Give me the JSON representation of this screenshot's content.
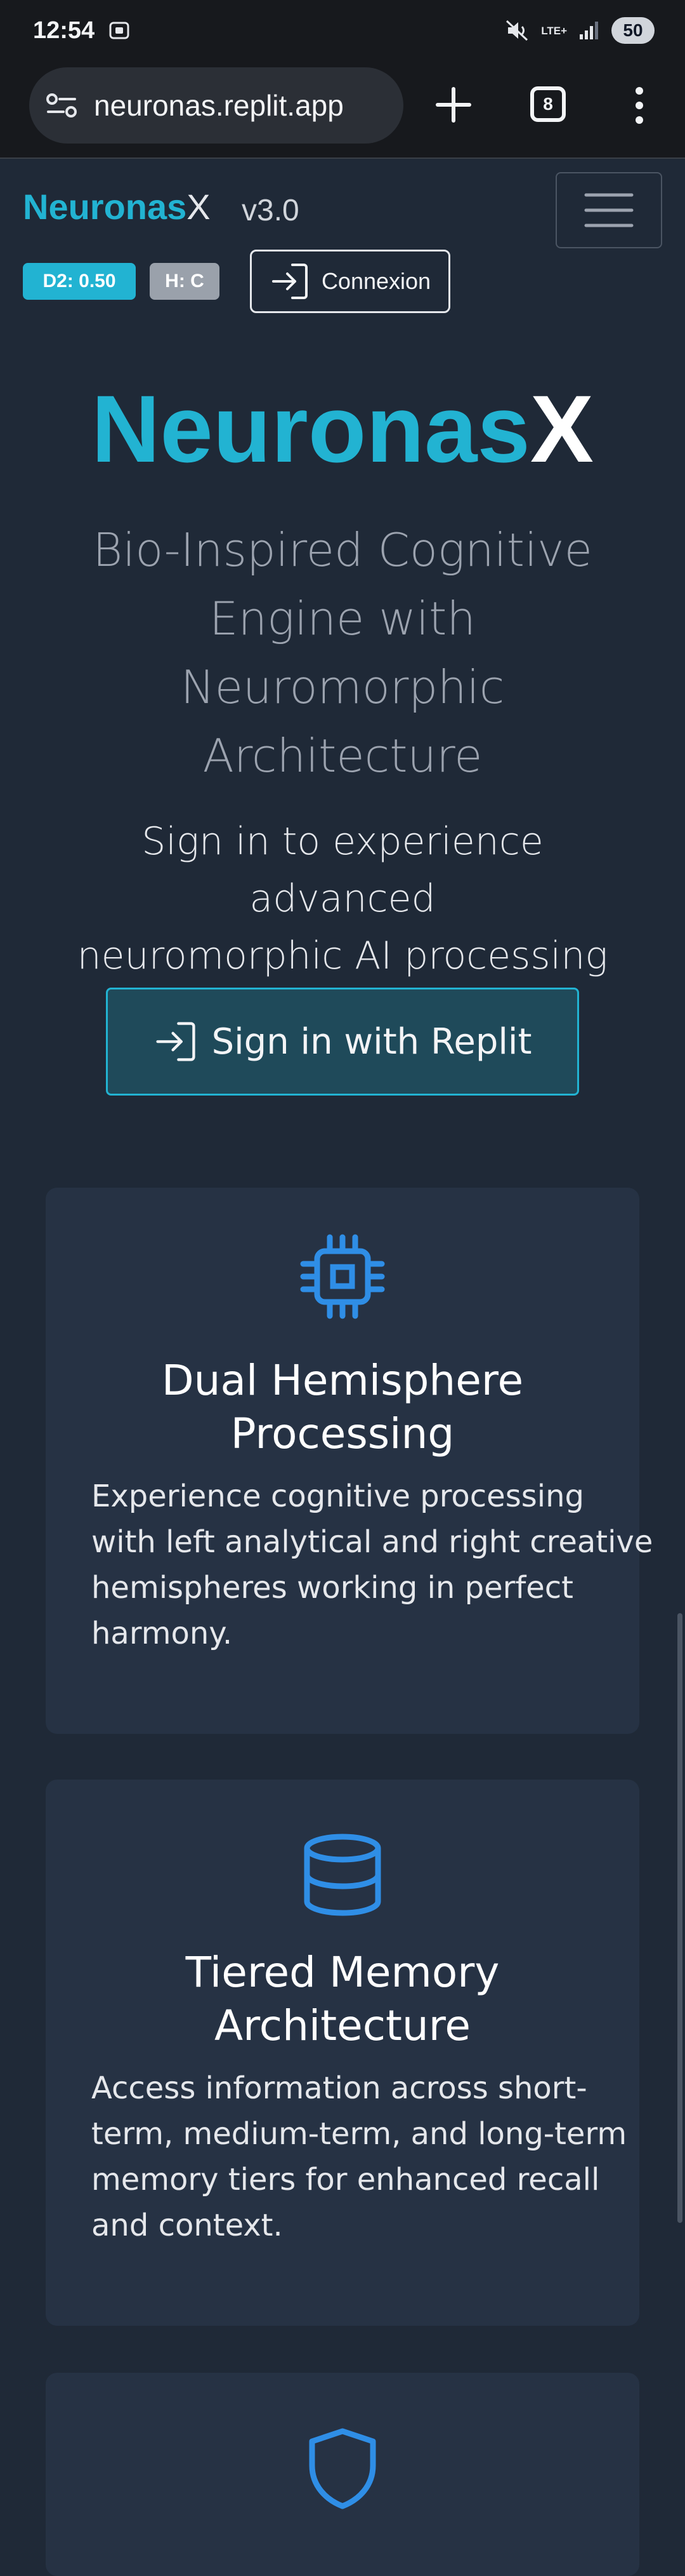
{
  "status_bar": {
    "time": "12:54",
    "network": "LTE+",
    "battery": "50"
  },
  "browser": {
    "url": "neuronas.replit.app",
    "tab_count": "8"
  },
  "navbar": {
    "brand_primary": "Neuronas",
    "brand_secondary": "X",
    "version": "v3.0",
    "badge_d2": "D2: 0.50",
    "badge_h": "H: C",
    "login_button": "Connexion"
  },
  "hero": {
    "title_primary": "Neuronas",
    "title_secondary": "X",
    "subtitle_lines": [
      "Bio-Inspired Cognitive",
      "Engine with Neuromorphic",
      "Architecture"
    ],
    "prompt_lines": [
      "Sign in to experience advanced",
      "neuromorphic AI processing"
    ],
    "signin_button": "Sign in with Replit"
  },
  "features": [
    {
      "icon": "cpu-chip-icon",
      "title_lines": [
        "Dual Hemisphere",
        "Processing"
      ],
      "text_lines": [
        "Experience cognitive processing",
        "with left analytical and right creative",
        "hemispheres working in perfect",
        "harmony."
      ]
    },
    {
      "icon": "database-icon",
      "title_lines": [
        "Tiered Memory",
        "Architecture"
      ],
      "text_lines": [
        "Access information across short-",
        "term, medium-term, and long-term",
        "memory tiers for enhanced recall",
        "and context."
      ]
    },
    {
      "icon": "shield-icon"
    }
  ],
  "colors": {
    "accent": "#22b3d2",
    "background": "#1f2937",
    "card": "#263244",
    "icon_blue": "#2f8ee6"
  }
}
